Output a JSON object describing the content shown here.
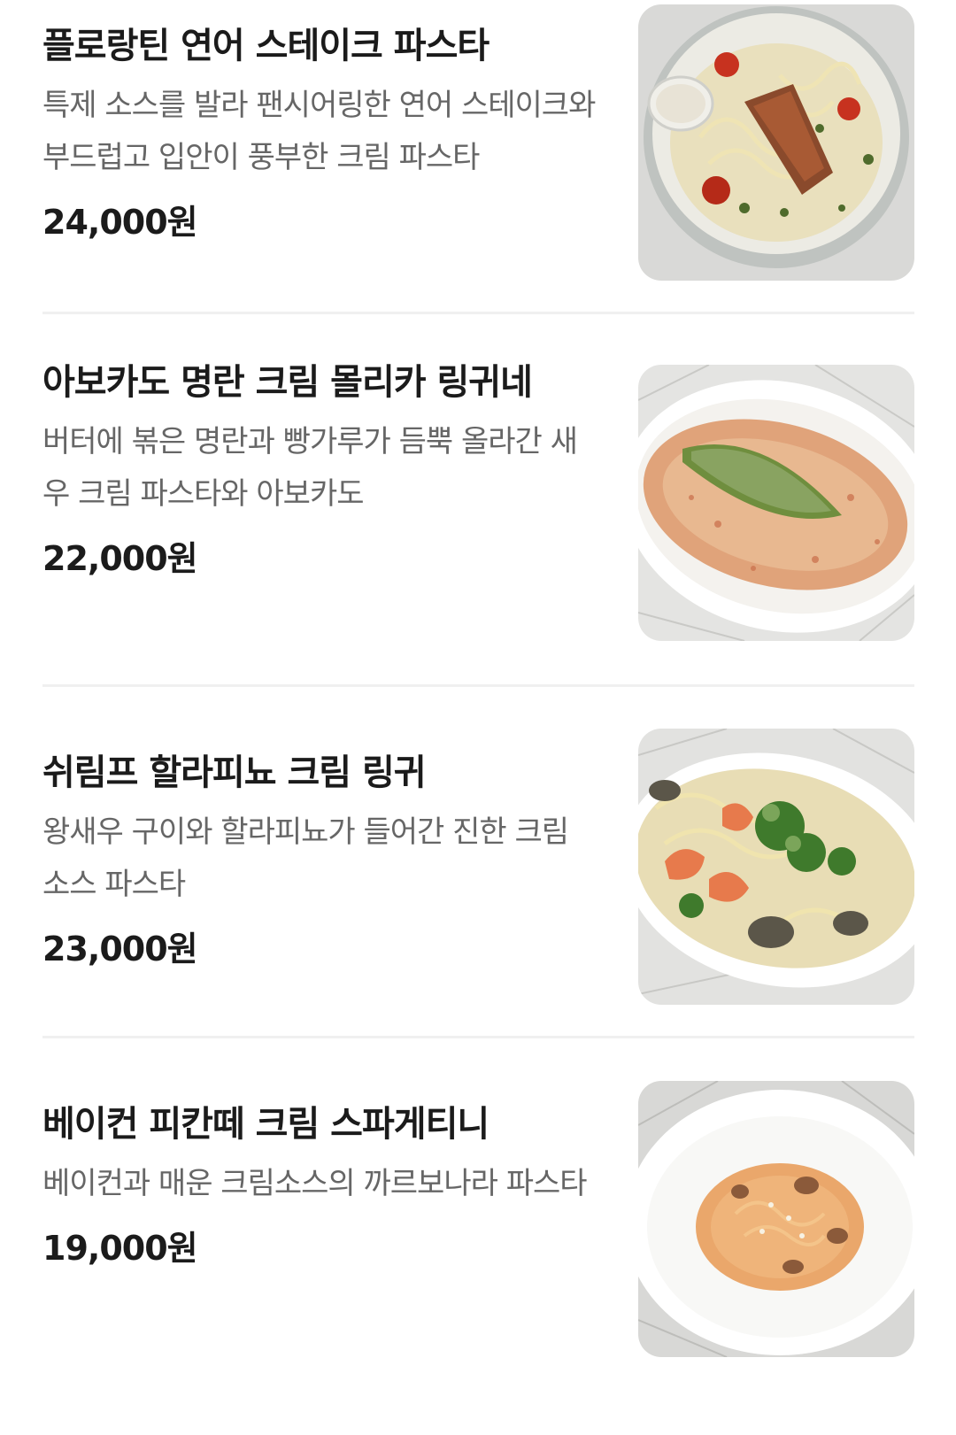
{
  "menu": {
    "items": [
      {
        "name": "플로랑틴 연어 스테이크 파스타",
        "description": "특제 소스를 발라 팬시어링한 연어 스테이크와 부드럽고 입안이 풍부한 크림 파스타",
        "price": "24,000원",
        "photo_icon": "salmon-steak-pasta-photo"
      },
      {
        "name": "아보카도 명란 크림 몰리카 링귀네",
        "description": "버터에 볶은 명란과 빵가루가 듬뿍 올라간 새우 크림 파스타와 아보카도",
        "price": "22,000원",
        "photo_icon": "avocado-mentaiko-linguine-photo"
      },
      {
        "name": "쉬림프 할라피뇨 크림 링귀",
        "description": "왕새우 구이와 할라피뇨가 들어간 진한 크림 소스 파스타",
        "price": "23,000원",
        "photo_icon": "shrimp-jalapeno-linguine-photo"
      },
      {
        "name": "베이컨 피칸떼 크림 스파게티니",
        "description": "베이컨과 매운 크림소스의 까르보나라 파스타",
        "price": "19,000원",
        "photo_icon": "bacon-piccante-spaghettini-photo"
      }
    ]
  }
}
